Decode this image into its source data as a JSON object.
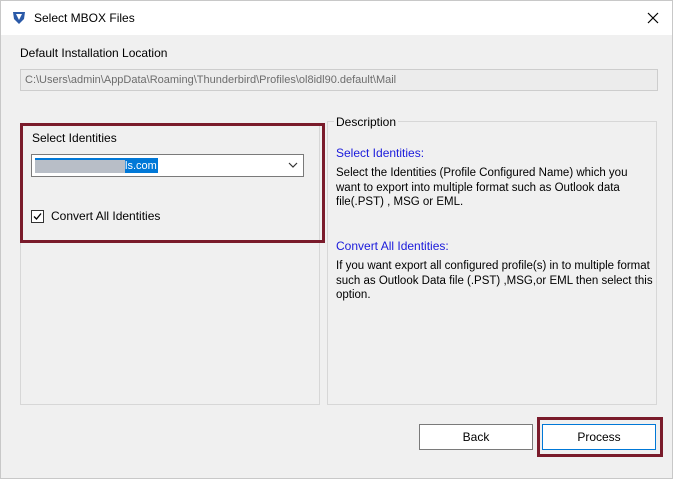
{
  "window": {
    "title": "Select MBOX Files"
  },
  "install": {
    "label": "Default Installation Location",
    "path": "C:\\Users\\admin\\AppData\\Roaming\\Thunderbird\\Profiles\\ol8idl90.default\\Mail"
  },
  "identities": {
    "label": "Select Identities",
    "selected_suffix": "ls.com",
    "convert_all_label": "Convert All Identities",
    "convert_all_checked": true
  },
  "description": {
    "title": "Description",
    "select_heading": "Select Identities:",
    "select_text": "Select the Identities (Profile Configured Name) which you want to export into multiple format such as Outlook data file(.PST) , MSG or EML.",
    "convert_heading": "Convert All Identities:",
    "convert_text": "If you want export all configured profile(s) in to multiple format such as Outlook Data file (.PST) ,MSG,or EML then select this option."
  },
  "buttons": {
    "back": "Back",
    "process": "Process"
  },
  "colors": {
    "highlight": "#7a1b2b",
    "heading_blue": "#1a1adb",
    "selection": "#0078d7"
  },
  "icons": {
    "app": "shield-logo-icon",
    "close": "close-icon",
    "dropdown": "chevron-down-icon",
    "check": "checkmark-icon"
  }
}
